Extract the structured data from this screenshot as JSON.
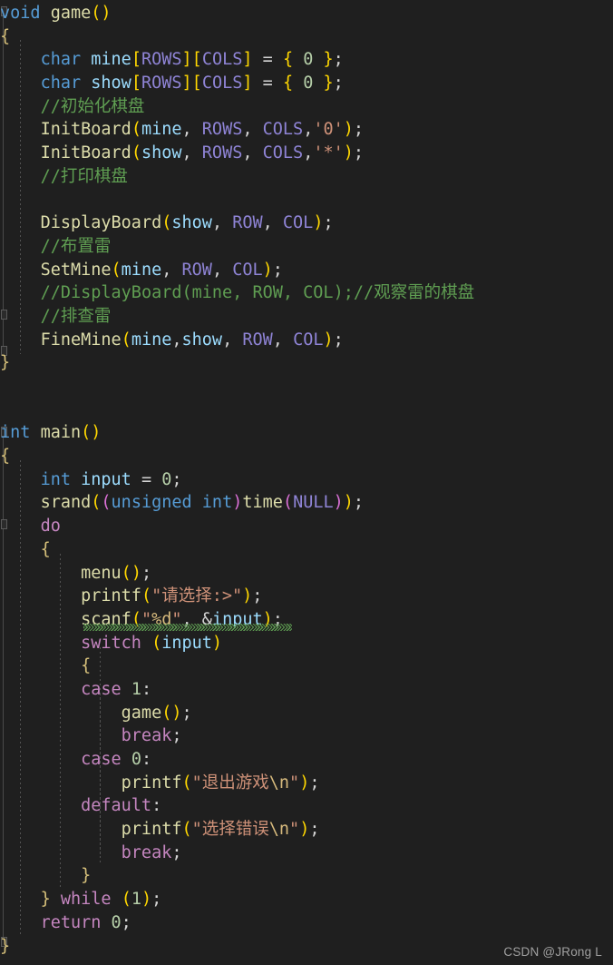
{
  "editor": {
    "background_color": "#1f1f1f",
    "default_text_color": "#d4d4d4",
    "font_size_px": 18.5,
    "line_height_px": 25.7,
    "language": "C"
  },
  "colors": {
    "keyword": "#569cd6",
    "control_keyword": "#c586c0",
    "variable": "#9cdcfe",
    "macro": "#8f84d6",
    "function": "#dcdcaa",
    "string": "#ce9178",
    "format_specifier": "#d7ba7d",
    "number": "#b5cea8",
    "comment": "#5f9e52",
    "punctuation": "#d4d4d4",
    "bracket_level_0": "#ffd700",
    "bracket_level_1": "#da70d6",
    "bracket_level_2": "#179fff",
    "squiggle_warning": "#5f9e52"
  },
  "watermark": {
    "text": "CSDN @JRong L"
  },
  "code": {
    "lines": [
      "void game()",
      "{",
      "    char mine[ROWS][COLS] = { 0 };",
      "    char show[ROWS][COLS] = { 0 };",
      "    //初始化棋盘",
      "    InitBoard(mine, ROWS, COLS,'0');",
      "    InitBoard(show, ROWS, COLS,'*');",
      "    //打印棋盘",
      "",
      "    DisplayBoard(show, ROW, COL);",
      "    //布置雷",
      "    SetMine(mine, ROW, COL);",
      "    //DisplayBoard(mine, ROW, COL);//观察雷的棋盘",
      "    //排查雷",
      "    FineMine(mine,show, ROW, COL);",
      "}",
      "",
      "",
      "int main()",
      "{",
      "    int input = 0;",
      "    srand((unsigned int)time(NULL));",
      "    do",
      "    {",
      "        menu();",
      "        printf(\"请选择:>\");",
      "        scanf(\"%d\", &input);",
      "        switch (input)",
      "        {",
      "        case 1:",
      "            game();",
      "            break;",
      "        case 0:",
      "            printf(\"退出游戏\\n\");",
      "        default:",
      "            printf(\"选择错误\\n\");",
      "            break;",
      "        }",
      "    } while (1);",
      "    return 0;",
      "}"
    ],
    "warnings": [
      {
        "line_index": 24,
        "text": "scanf(\"%d\", &input);",
        "type": "deprecation-warning"
      }
    ]
  }
}
